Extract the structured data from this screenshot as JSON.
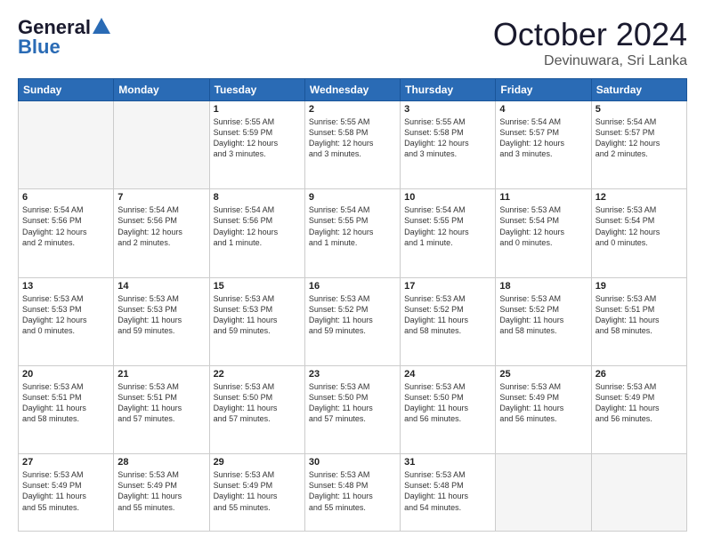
{
  "header": {
    "logo_general": "General",
    "logo_blue": "Blue",
    "month": "October 2024",
    "location": "Devinuwara, Sri Lanka"
  },
  "days_of_week": [
    "Sunday",
    "Monday",
    "Tuesday",
    "Wednesday",
    "Thursday",
    "Friday",
    "Saturday"
  ],
  "weeks": [
    [
      {
        "day": "",
        "info": ""
      },
      {
        "day": "",
        "info": ""
      },
      {
        "day": "1",
        "info": "Sunrise: 5:55 AM\nSunset: 5:59 PM\nDaylight: 12 hours\nand 3 minutes."
      },
      {
        "day": "2",
        "info": "Sunrise: 5:55 AM\nSunset: 5:58 PM\nDaylight: 12 hours\nand 3 minutes."
      },
      {
        "day": "3",
        "info": "Sunrise: 5:55 AM\nSunset: 5:58 PM\nDaylight: 12 hours\nand 3 minutes."
      },
      {
        "day": "4",
        "info": "Sunrise: 5:54 AM\nSunset: 5:57 PM\nDaylight: 12 hours\nand 3 minutes."
      },
      {
        "day": "5",
        "info": "Sunrise: 5:54 AM\nSunset: 5:57 PM\nDaylight: 12 hours\nand 2 minutes."
      }
    ],
    [
      {
        "day": "6",
        "info": "Sunrise: 5:54 AM\nSunset: 5:56 PM\nDaylight: 12 hours\nand 2 minutes."
      },
      {
        "day": "7",
        "info": "Sunrise: 5:54 AM\nSunset: 5:56 PM\nDaylight: 12 hours\nand 2 minutes."
      },
      {
        "day": "8",
        "info": "Sunrise: 5:54 AM\nSunset: 5:56 PM\nDaylight: 12 hours\nand 1 minute."
      },
      {
        "day": "9",
        "info": "Sunrise: 5:54 AM\nSunset: 5:55 PM\nDaylight: 12 hours\nand 1 minute."
      },
      {
        "day": "10",
        "info": "Sunrise: 5:54 AM\nSunset: 5:55 PM\nDaylight: 12 hours\nand 1 minute."
      },
      {
        "day": "11",
        "info": "Sunrise: 5:53 AM\nSunset: 5:54 PM\nDaylight: 12 hours\nand 0 minutes."
      },
      {
        "day": "12",
        "info": "Sunrise: 5:53 AM\nSunset: 5:54 PM\nDaylight: 12 hours\nand 0 minutes."
      }
    ],
    [
      {
        "day": "13",
        "info": "Sunrise: 5:53 AM\nSunset: 5:53 PM\nDaylight: 12 hours\nand 0 minutes."
      },
      {
        "day": "14",
        "info": "Sunrise: 5:53 AM\nSunset: 5:53 PM\nDaylight: 11 hours\nand 59 minutes."
      },
      {
        "day": "15",
        "info": "Sunrise: 5:53 AM\nSunset: 5:53 PM\nDaylight: 11 hours\nand 59 minutes."
      },
      {
        "day": "16",
        "info": "Sunrise: 5:53 AM\nSunset: 5:52 PM\nDaylight: 11 hours\nand 59 minutes."
      },
      {
        "day": "17",
        "info": "Sunrise: 5:53 AM\nSunset: 5:52 PM\nDaylight: 11 hours\nand 58 minutes."
      },
      {
        "day": "18",
        "info": "Sunrise: 5:53 AM\nSunset: 5:52 PM\nDaylight: 11 hours\nand 58 minutes."
      },
      {
        "day": "19",
        "info": "Sunrise: 5:53 AM\nSunset: 5:51 PM\nDaylight: 11 hours\nand 58 minutes."
      }
    ],
    [
      {
        "day": "20",
        "info": "Sunrise: 5:53 AM\nSunset: 5:51 PM\nDaylight: 11 hours\nand 58 minutes."
      },
      {
        "day": "21",
        "info": "Sunrise: 5:53 AM\nSunset: 5:51 PM\nDaylight: 11 hours\nand 57 minutes."
      },
      {
        "day": "22",
        "info": "Sunrise: 5:53 AM\nSunset: 5:50 PM\nDaylight: 11 hours\nand 57 minutes."
      },
      {
        "day": "23",
        "info": "Sunrise: 5:53 AM\nSunset: 5:50 PM\nDaylight: 11 hours\nand 57 minutes."
      },
      {
        "day": "24",
        "info": "Sunrise: 5:53 AM\nSunset: 5:50 PM\nDaylight: 11 hours\nand 56 minutes."
      },
      {
        "day": "25",
        "info": "Sunrise: 5:53 AM\nSunset: 5:49 PM\nDaylight: 11 hours\nand 56 minutes."
      },
      {
        "day": "26",
        "info": "Sunrise: 5:53 AM\nSunset: 5:49 PM\nDaylight: 11 hours\nand 56 minutes."
      }
    ],
    [
      {
        "day": "27",
        "info": "Sunrise: 5:53 AM\nSunset: 5:49 PM\nDaylight: 11 hours\nand 55 minutes."
      },
      {
        "day": "28",
        "info": "Sunrise: 5:53 AM\nSunset: 5:49 PM\nDaylight: 11 hours\nand 55 minutes."
      },
      {
        "day": "29",
        "info": "Sunrise: 5:53 AM\nSunset: 5:49 PM\nDaylight: 11 hours\nand 55 minutes."
      },
      {
        "day": "30",
        "info": "Sunrise: 5:53 AM\nSunset: 5:48 PM\nDaylight: 11 hours\nand 55 minutes."
      },
      {
        "day": "31",
        "info": "Sunrise: 5:53 AM\nSunset: 5:48 PM\nDaylight: 11 hours\nand 54 minutes."
      },
      {
        "day": "",
        "info": ""
      },
      {
        "day": "",
        "info": ""
      }
    ]
  ]
}
